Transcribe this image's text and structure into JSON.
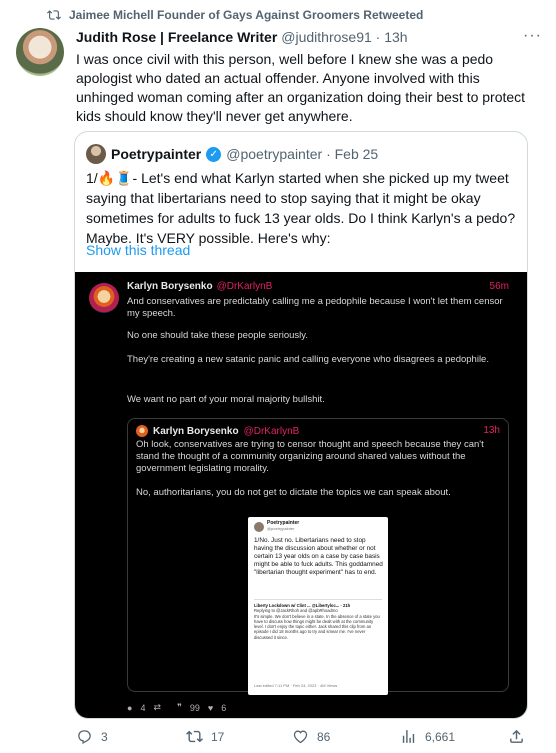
{
  "retweet": {
    "text": "Jaimee Michell Founder of Gays Against Groomers Retweeted",
    "icon": "retweet-icon"
  },
  "tweet": {
    "name": "Judith Rose | Freelance Writer",
    "handle": "@judithrose91 · 13h",
    "more": "···",
    "text": "I was once civil with this person, well before I knew she was a pedo apologist who dated an actual offender. Anyone involved with this unhinged woman coming after an organization doing their best to protect kids should know they'll never get anywhere."
  },
  "quote": {
    "name": "Poetrypainter",
    "handle": "@poetrypainter · Feb 25",
    "text": "1/🔥🧵- Let's end what Karlyn started when she picked up my tweet saying that libertarians need to stop saying that it might be okay sometimes for adults to fuck 13 year olds.  Do I think Karlyn's a pedo? Maybe.  It's VERY possible.  Here's why:",
    "show_thread": "Show this thread"
  },
  "screenshot": {
    "name": "Karlyn Borysenko",
    "handle": "@DrKarlynB",
    "time": "56m",
    "p1": "And conservatives are predictably calling me a pedophile because I won't let them censor my speech.",
    "p2": "No one should take these people seriously.",
    "p3": "They're creating a new satanic panic and calling everyone who disagrees a pedophile.",
    "p4": "We want no part of your moral majority bullshit.",
    "inner": {
      "name": "Karlyn Borysenko",
      "handle": "@DrKarlynB",
      "time": "13h",
      "p1": "Oh look, conservatives are trying to censor thought and speech because they can't stand the thought of a community organizing around shared values without the government legislating morality.",
      "p2": "No, authoritarians, you do not get to dictate the topics we can speak about."
    },
    "image": {
      "name": "Poetrypainter",
      "handle": "@poetrypainter",
      "body": "1/No.  Just no.  Libertarians need to stop having the discussion about whether or not certain 13 year olds on a case by case basis might be able to fuck adults.  This goddamned \"libertarian thought experiment\" has to end.",
      "q_name": "Liberty Lockdown w/ Clint ... @Libertyloc... · 21h",
      "q_reply": "Replying to @JackRhoh and @apbRhoadmo",
      "q_body": "It's simple. We don't believe in a state. In the absence of a state you have to discuss how things might be dealt with at the community level. I don't enjoy the topic either. Jack shared this clip from an episode I did 18 months ago to try and smear me. I've never discussed it since.",
      "foot": "Last edited 7:11 PM · Feb 24, 2023 · 4M Views"
    },
    "stats": {
      "replies": "4",
      "retweets": "",
      "quotes": "99",
      "likes": "6"
    }
  },
  "actions": {
    "replies": "3",
    "retweets": "17",
    "likes": "86",
    "views": "6,661"
  }
}
